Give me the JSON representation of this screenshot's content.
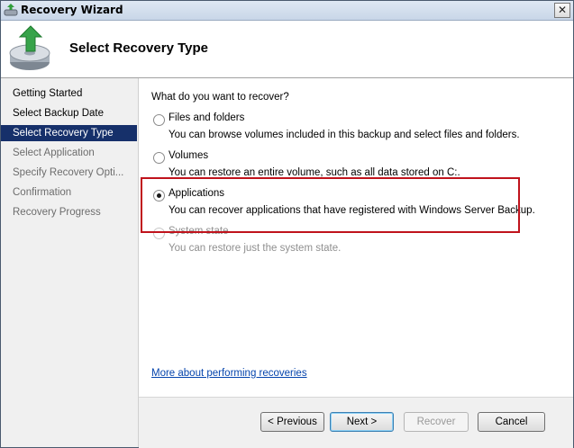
{
  "window": {
    "title": "Recovery Wizard",
    "close_glyph": "✕"
  },
  "header": {
    "title": "Select Recovery Type",
    "icon": "backup-restore-disk-icon"
  },
  "sidebar": {
    "steps": [
      {
        "label": "Getting Started",
        "state": "done"
      },
      {
        "label": "Select Backup Date",
        "state": "done"
      },
      {
        "label": "Select Recovery Type",
        "state": "active"
      },
      {
        "label": "Select Application",
        "state": "pending"
      },
      {
        "label": "Specify Recovery Opti...",
        "state": "pending"
      },
      {
        "label": "Confirmation",
        "state": "pending"
      },
      {
        "label": "Recovery Progress",
        "state": "pending"
      }
    ]
  },
  "main": {
    "question": "What do you want to recover?",
    "options": [
      {
        "label": "Files and folders",
        "description": "You can browse volumes included in this backup and select files and folders.",
        "checked": false,
        "enabled": true
      },
      {
        "label": "Volumes",
        "description": "You can restore an entire volume, such as all data stored on C:.",
        "checked": false,
        "enabled": true
      },
      {
        "label": "Applications",
        "description": "You can recover applications that have registered with Windows Server Backup.",
        "checked": true,
        "enabled": true
      },
      {
        "label": "System state",
        "description": "You can restore just the system state.",
        "checked": false,
        "enabled": false
      }
    ],
    "help_link": "More about performing recoveries"
  },
  "footer": {
    "previous_label": "< Previous",
    "next_label": "Next >",
    "recover_label": "Recover",
    "cancel_label": "Cancel"
  },
  "colors": {
    "accent": "#16306a",
    "highlight_box": "#c0131c",
    "link": "#0645ad"
  }
}
